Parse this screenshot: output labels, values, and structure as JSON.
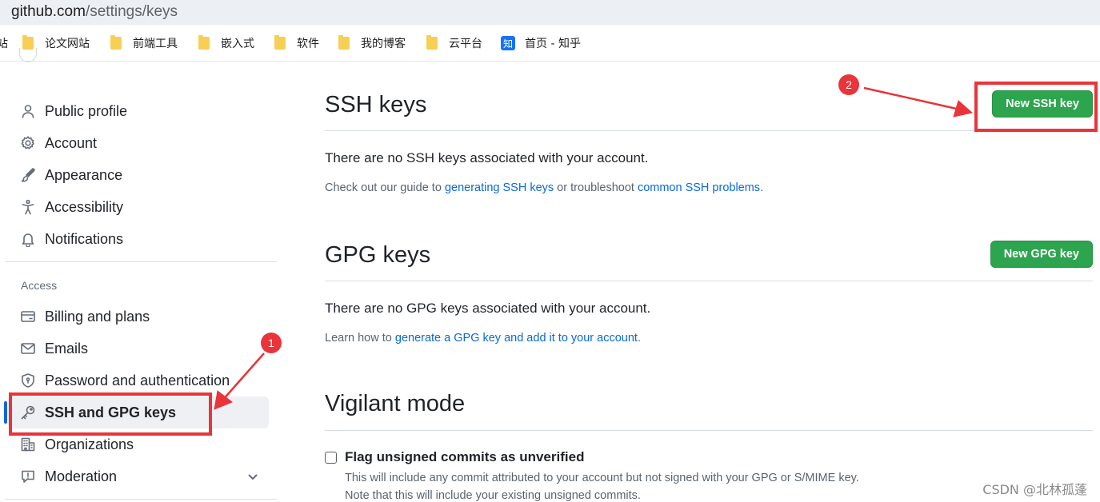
{
  "browser": {
    "url_host": "github.com",
    "url_path": "/settings/keys",
    "bookmarks": [
      {
        "label": "论文网站",
        "icon": "folder-icon"
      },
      {
        "label": "前端工具",
        "icon": "folder-icon"
      },
      {
        "label": "嵌入式",
        "icon": "folder-icon"
      },
      {
        "label": "软件",
        "icon": "folder-icon"
      },
      {
        "label": "我的博客",
        "icon": "folder-icon"
      },
      {
        "label": "云平台",
        "icon": "folder-icon"
      },
      {
        "label": "首页 - 知乎",
        "icon": "zhihu-icon",
        "icon_text": "知"
      }
    ],
    "cut_bookmark_glyph": "站"
  },
  "sidebar": {
    "items": [
      {
        "label": "Public profile",
        "icon": "person-icon"
      },
      {
        "label": "Account",
        "icon": "gear-icon"
      },
      {
        "label": "Appearance",
        "icon": "paintbrush-icon"
      },
      {
        "label": "Accessibility",
        "icon": "accessibility-icon"
      },
      {
        "label": "Notifications",
        "icon": "bell-icon"
      }
    ],
    "access_heading": "Access",
    "access_items": [
      {
        "label": "Billing and plans",
        "icon": "credit-card-icon"
      },
      {
        "label": "Emails",
        "icon": "mail-icon"
      },
      {
        "label": "Password and authentication",
        "icon": "shield-lock-icon"
      },
      {
        "label": "SSH and GPG keys",
        "icon": "key-icon",
        "active": true
      },
      {
        "label": "Organizations",
        "icon": "organization-icon"
      },
      {
        "label": "Moderation",
        "icon": "report-icon"
      }
    ]
  },
  "main": {
    "ssh": {
      "title": "SSH keys",
      "button": "New SSH key",
      "empty": "There are no SSH keys associated with your account.",
      "note_prefix": "Check out our guide to ",
      "note_link1": "generating SSH keys",
      "note_middle": " or troubleshoot ",
      "note_link2": "common SSH problems",
      "note_suffix": "."
    },
    "gpg": {
      "title": "GPG keys",
      "button": "New GPG key",
      "empty": "There are no GPG keys associated with your account.",
      "note_prefix": "Learn how to ",
      "note_link": "generate a GPG key and add it to your account",
      "note_suffix": "."
    },
    "vigilant": {
      "title": "Vigilant mode",
      "checkbox_label": "Flag unsigned commits as unverified",
      "checked": false,
      "desc1": "This will include any commit attributed to your account but not signed with your GPG or S/MIME key.",
      "desc2": "Note that this will include your existing unsigned commits."
    }
  },
  "annotations": {
    "badge1": "1",
    "badge2": "2",
    "color": "#e8343a"
  },
  "watermark": "CSDN @北林孤蓬",
  "colors": {
    "accent_blue": "#0969da",
    "button_green": "#2da44e"
  }
}
